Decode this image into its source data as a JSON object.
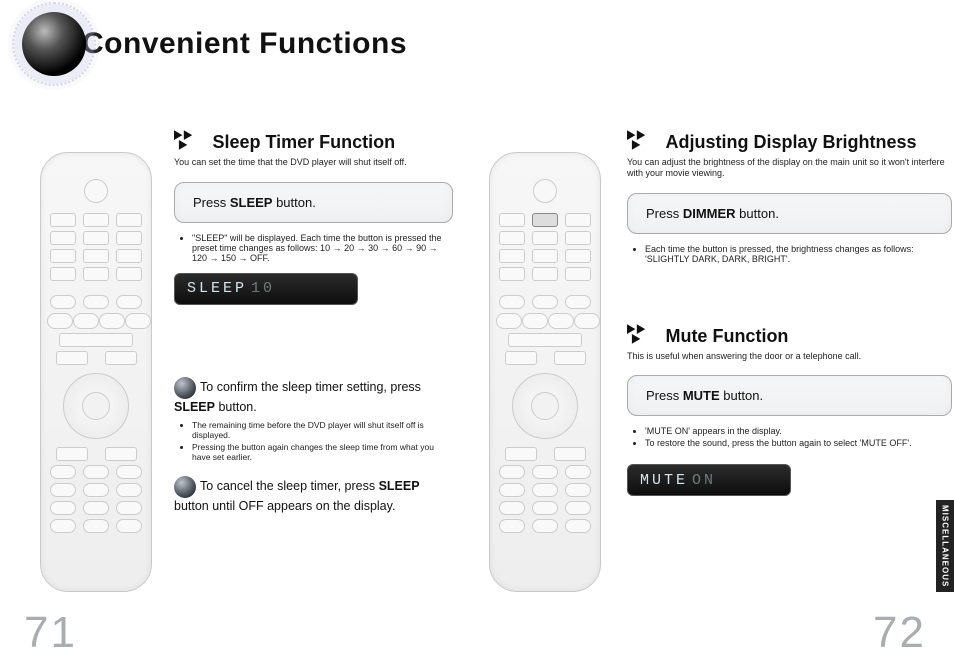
{
  "title": "Convenient Functions",
  "left": {
    "section": {
      "heading": "Sleep Timer Function",
      "sub": "You can set the time that the DVD player will shut itself off."
    },
    "step_press_prefix": "Press ",
    "step_press_bold": "SLEEP",
    "step_press_suffix": " button.",
    "notes": [
      "\"SLEEP\" will be displayed. Each time the button is pressed the preset time changes as follows: 10 → 20 → 30 → 60 → 90 → 120 → 150 → OFF."
    ],
    "lcd_text": "SLEEP",
    "lcd_value": "10",
    "instr1_mid": "confirm the sleep timer setting, press ",
    "instr1_bold": "SLEEP",
    "instr1_end": " button.",
    "instr1_notes": [
      "The remaining time before the DVD player will shut itself off is displayed.",
      "Pressing the button again changes the sleep time from what you have set earlier."
    ],
    "instr2_mid": "cancel the sleep timer, press ",
    "instr2_bold": "SLEEP",
    "instr2_end": " button until OFF appears on the display.",
    "to_label": "To "
  },
  "right": {
    "sectionA": {
      "heading": "Adjusting Display Brightness",
      "sub": "You can adjust the brightness of the display on the main unit so it won't interfere with your movie viewing."
    },
    "stepA_press_prefix": "Press ",
    "stepA_press_bold": "DIMMER",
    "stepA_press_suffix": " button.",
    "notesA": [
      "Each time the button is pressed, the brightness changes as follows: 'SLIGHTLY DARK, DARK, BRIGHT'."
    ],
    "sectionB": {
      "heading": "Mute Function",
      "sub": "This is useful when answering the door or a telephone call."
    },
    "stepB_press_prefix": "Press ",
    "stepB_press_bold": "MUTE",
    "stepB_press_suffix": " button.",
    "notesB": [
      "'MUTE ON' appears in the display.",
      "To restore the sound, press the button again to select 'MUTE OFF'."
    ],
    "lcdB_text": "MUTE",
    "lcdB_value": "ON"
  },
  "side_tab": "MISCELLANEOUS",
  "page_numbers": {
    "left": "71",
    "right": "72"
  }
}
